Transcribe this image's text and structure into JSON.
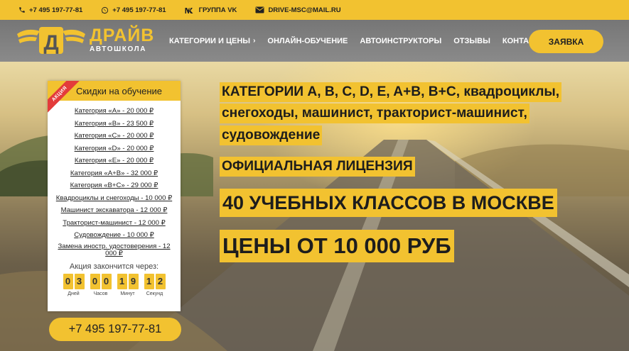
{
  "topbar": {
    "phone1": "+7 495 197-77-81",
    "phone2": "+7 495 197-77-81",
    "vk": "ГРУППА VK",
    "email": "DRIVE-MSC@MAIL.RU"
  },
  "logo": {
    "letter": "Д",
    "name": "ДРАЙВ",
    "subtitle": "АВТОШКОЛА"
  },
  "nav": {
    "items": [
      {
        "label": "КАТЕГОРИИ И ЦЕНЫ",
        "arrow": "›"
      },
      {
        "label": "ОНЛАЙН-ОБУЧЕНИЕ"
      },
      {
        "label": "АВТОИНСТРУКТОРЫ"
      },
      {
        "label": "ОТЗЫВЫ"
      },
      {
        "label": "КОНТАКТЫ"
      }
    ],
    "cta": "ЗАЯВКА"
  },
  "card": {
    "ribbon": "АКЦИЯ",
    "title": "Скидки на обучение",
    "prices": [
      "Категория «A» - 20 000 ₽",
      "Категория «B» - 23 500 ₽",
      "Категория «C» - 20 000 ₽",
      "Категория «D» - 20 000 ₽",
      "Категория «E» - 20 000 ₽",
      "Категория «A+B» - 32 000 ₽",
      "Категория «B+C» - 29 000 ₽",
      "Квадроциклы и снегоходы - 10 000 ₽",
      "Машинист экскаватора - 12 000 ₽",
      "Тракторист-машинист - 12 000 ₽",
      "Судовождение - 10 000 ₽",
      "Замена иностр. удостоверения - 12 000 ₽"
    ],
    "promo_label": "Акция закончится через:",
    "timer": [
      {
        "digits": "03",
        "unit": "Дней"
      },
      {
        "digits": "00",
        "unit": "Часов"
      },
      {
        "digits": "19",
        "unit": "Минут"
      },
      {
        "digits": "12",
        "unit": "Секунд"
      }
    ]
  },
  "phone_button": "+7 495 197-77-81",
  "headlines": {
    "line1": "КАТЕГОРИИ A, B, C, D, E, A+B, B+C, квадроциклы,",
    "line2": "снегоходы, машинист, тракторист-машинист,",
    "line3": "судовождение",
    "license": "ОФИЦИАЛЬНАЯ ЛИЦЕНЗИЯ",
    "classes": "40 УЧЕБНЫХ КЛАССОВ В МОСКВЕ",
    "price": "ЦЕНЫ ОТ 10 000 РУБ"
  },
  "colors": {
    "accent": "#f2c230",
    "ribbon": "#e33b3b",
    "text": "#222222"
  },
  "icons": [
    "phone-icon",
    "whatsapp-icon",
    "vk-icon",
    "mail-icon",
    "chevron-right-icon"
  ]
}
